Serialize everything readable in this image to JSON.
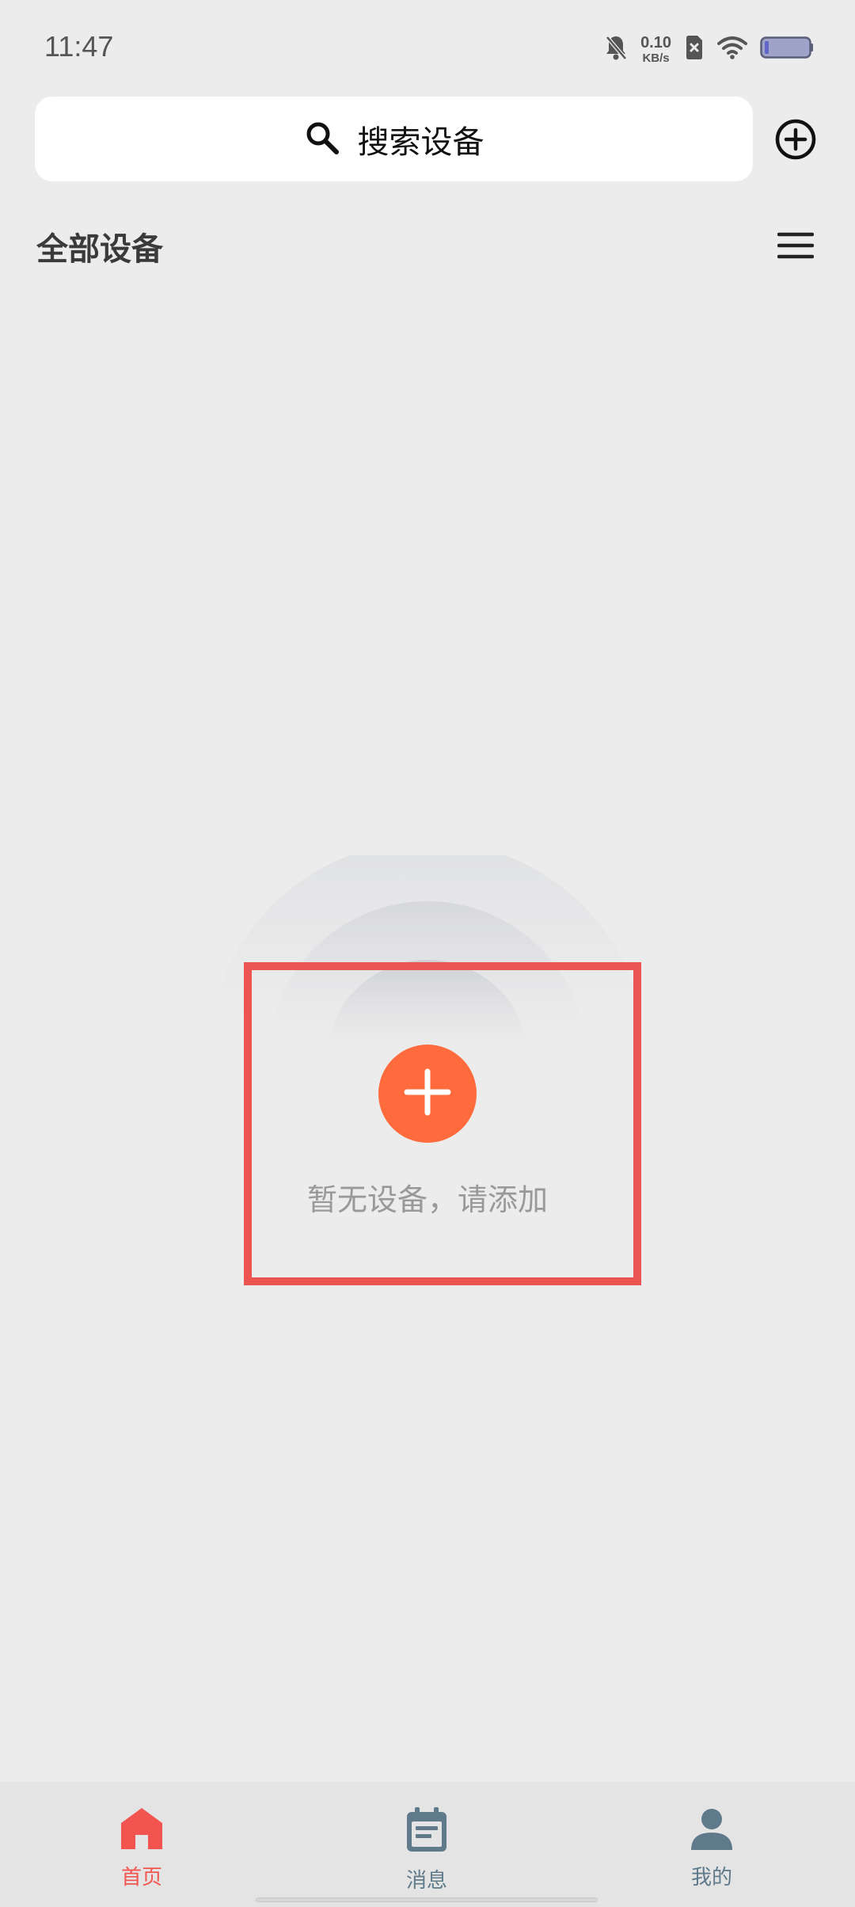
{
  "status_bar": {
    "time": "11:47",
    "net_speed_value": "0.10",
    "net_speed_unit": "KB/s",
    "icons": [
      "bell-off-icon",
      "sim-error-icon",
      "wifi-icon",
      "battery-icon"
    ]
  },
  "search": {
    "label": "搜索设备",
    "icon": "search-icon"
  },
  "header": {
    "add_icon": "plus-circle-icon",
    "title": "全部设备",
    "menu_icon": "hamburger-menu-icon"
  },
  "empty_state": {
    "add_icon": "plus-icon",
    "message": "暂无设备，请添加"
  },
  "tabs": [
    {
      "label": "首页",
      "icon": "home-icon",
      "active": true
    },
    {
      "label": "消息",
      "icon": "calendar-icon",
      "active": false
    },
    {
      "label": "我的",
      "icon": "person-icon",
      "active": false
    }
  ],
  "colors": {
    "accent": "#ff6b3d",
    "active_tab": "#f2554f",
    "inactive_tab": "#5f7a8a",
    "highlight": "#eb5451",
    "background": "#ececec"
  }
}
